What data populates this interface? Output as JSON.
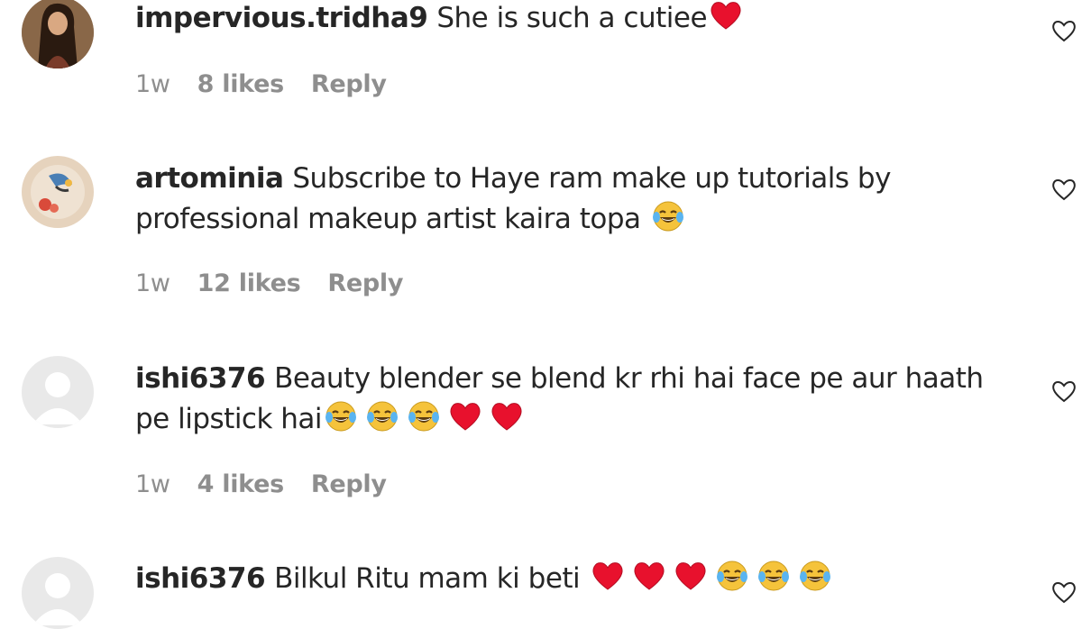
{
  "comments": [
    {
      "username": "impervious.tridha9",
      "text": "She is such a cutiee",
      "emojis": [
        "red-heart"
      ],
      "time": "1w",
      "likes": "8 likes",
      "reply": "Reply",
      "avatar": "photo-woman"
    },
    {
      "username": "artominia",
      "text": "Subscribe to Haye ram make up tutorials by professional makeup artist kaira topa",
      "emojis": [
        "tears-of-joy"
      ],
      "time": "1w",
      "likes": "12 likes",
      "reply": "Reply",
      "avatar": "artwork"
    },
    {
      "username": "ishi6376",
      "text": "Beauty blender se blend kr rhi hai face pe aur haath pe lipstick hai",
      "emojis": [
        "tears-of-joy",
        "tears-of-joy",
        "tears-of-joy",
        "red-heart",
        "red-heart"
      ],
      "time": "1w",
      "likes": "4 likes",
      "reply": "Reply",
      "avatar": "default-profile"
    },
    {
      "username": "ishi6376",
      "text": "Bilkul Ritu mam ki beti",
      "emojis": [
        "red-heart",
        "red-heart",
        "red-heart",
        "tears-of-joy",
        "tears-of-joy",
        "tears-of-joy"
      ],
      "avatar": "default-profile"
    }
  ],
  "icons": {
    "like": "heart-outline-icon"
  },
  "colors": {
    "meta": "#8e8e8e",
    "text": "#262626",
    "heart": "#e8112d",
    "emoji_face": "#f5c33b"
  }
}
